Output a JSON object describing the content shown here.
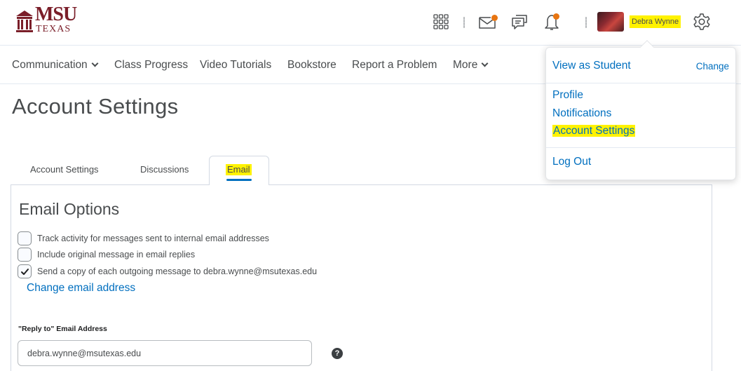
{
  "brand": {
    "logo_main": "MSU",
    "logo_sub": "TEXAS",
    "color": "#7a1e29"
  },
  "header": {
    "icons": [
      "grid-icon",
      "mail-icon",
      "chat-icon",
      "bell-icon",
      "gear-icon"
    ],
    "user_name": "Debra Wynne",
    "notification_color": "#e87511"
  },
  "nav": {
    "items": [
      {
        "label": "Communication",
        "has_chevron": true
      },
      {
        "label": "Class Progress"
      },
      {
        "label": "Video Tutorials"
      },
      {
        "label": "Bookstore"
      },
      {
        "label": "Report a Problem"
      },
      {
        "label": "More",
        "has_chevron": true
      }
    ]
  },
  "page": {
    "title": "Account Settings"
  },
  "tabs": [
    {
      "label": "Account Settings",
      "active": false
    },
    {
      "label": "Discussions",
      "active": false
    },
    {
      "label": "Email",
      "active": true
    }
  ],
  "email_options": {
    "title": "Email Options",
    "options": [
      {
        "label": "Track activity for messages sent to internal email addresses",
        "checked": false
      },
      {
        "label": "Include original message in email replies",
        "checked": false
      },
      {
        "label": "Send a copy of each outgoing message to debra.wynne@msutexas.edu",
        "checked": true
      }
    ],
    "change_email_link": "Change email address",
    "reply_to_label": "\"Reply to\" Email Address",
    "reply_to_value": "debra.wynne@msutexas.edu",
    "help_glyph": "?"
  },
  "user_menu": {
    "view_as_student": "View as Student",
    "change": "Change",
    "items": [
      "Profile",
      "Notifications",
      "Account Settings"
    ],
    "logout": "Log Out"
  },
  "colors": {
    "link": "#006fbf",
    "highlight": "#fff200",
    "text": "#494c4e"
  }
}
